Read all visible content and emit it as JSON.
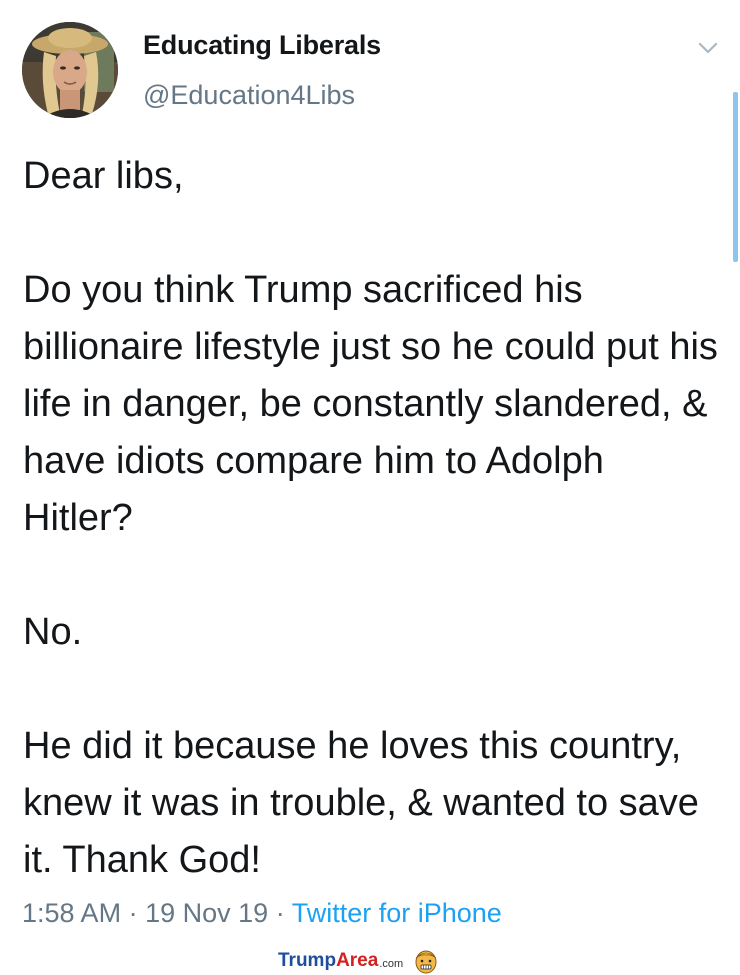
{
  "author": {
    "display_name": "Educating Liberals",
    "handle": "@Education4Libs"
  },
  "icons": {
    "menu": "chevron-down-icon",
    "avatar": "avatar-photo"
  },
  "tweet": {
    "paragraphs": [
      "Dear libs,",
      "Do you think Trump sacrificed his billionaire lifestyle just so he could put his life in danger, be constantly slandered, & have idiots compare him to Adolph Hitler?",
      "No.",
      "He did it because he loves this country, knew it was in trouble, & wanted to save it. Thank God!"
    ],
    "time": "1:58 AM",
    "separator": "·",
    "date": "19 Nov 19",
    "source": "Twitter for iPhone"
  },
  "watermark": {
    "part1": "Trump",
    "part2": "Area",
    "part3": ".com"
  },
  "colors": {
    "text": "#14171a",
    "secondary": "#657786",
    "link": "#1da1f2",
    "scrollbar": "#8ec5ec"
  }
}
